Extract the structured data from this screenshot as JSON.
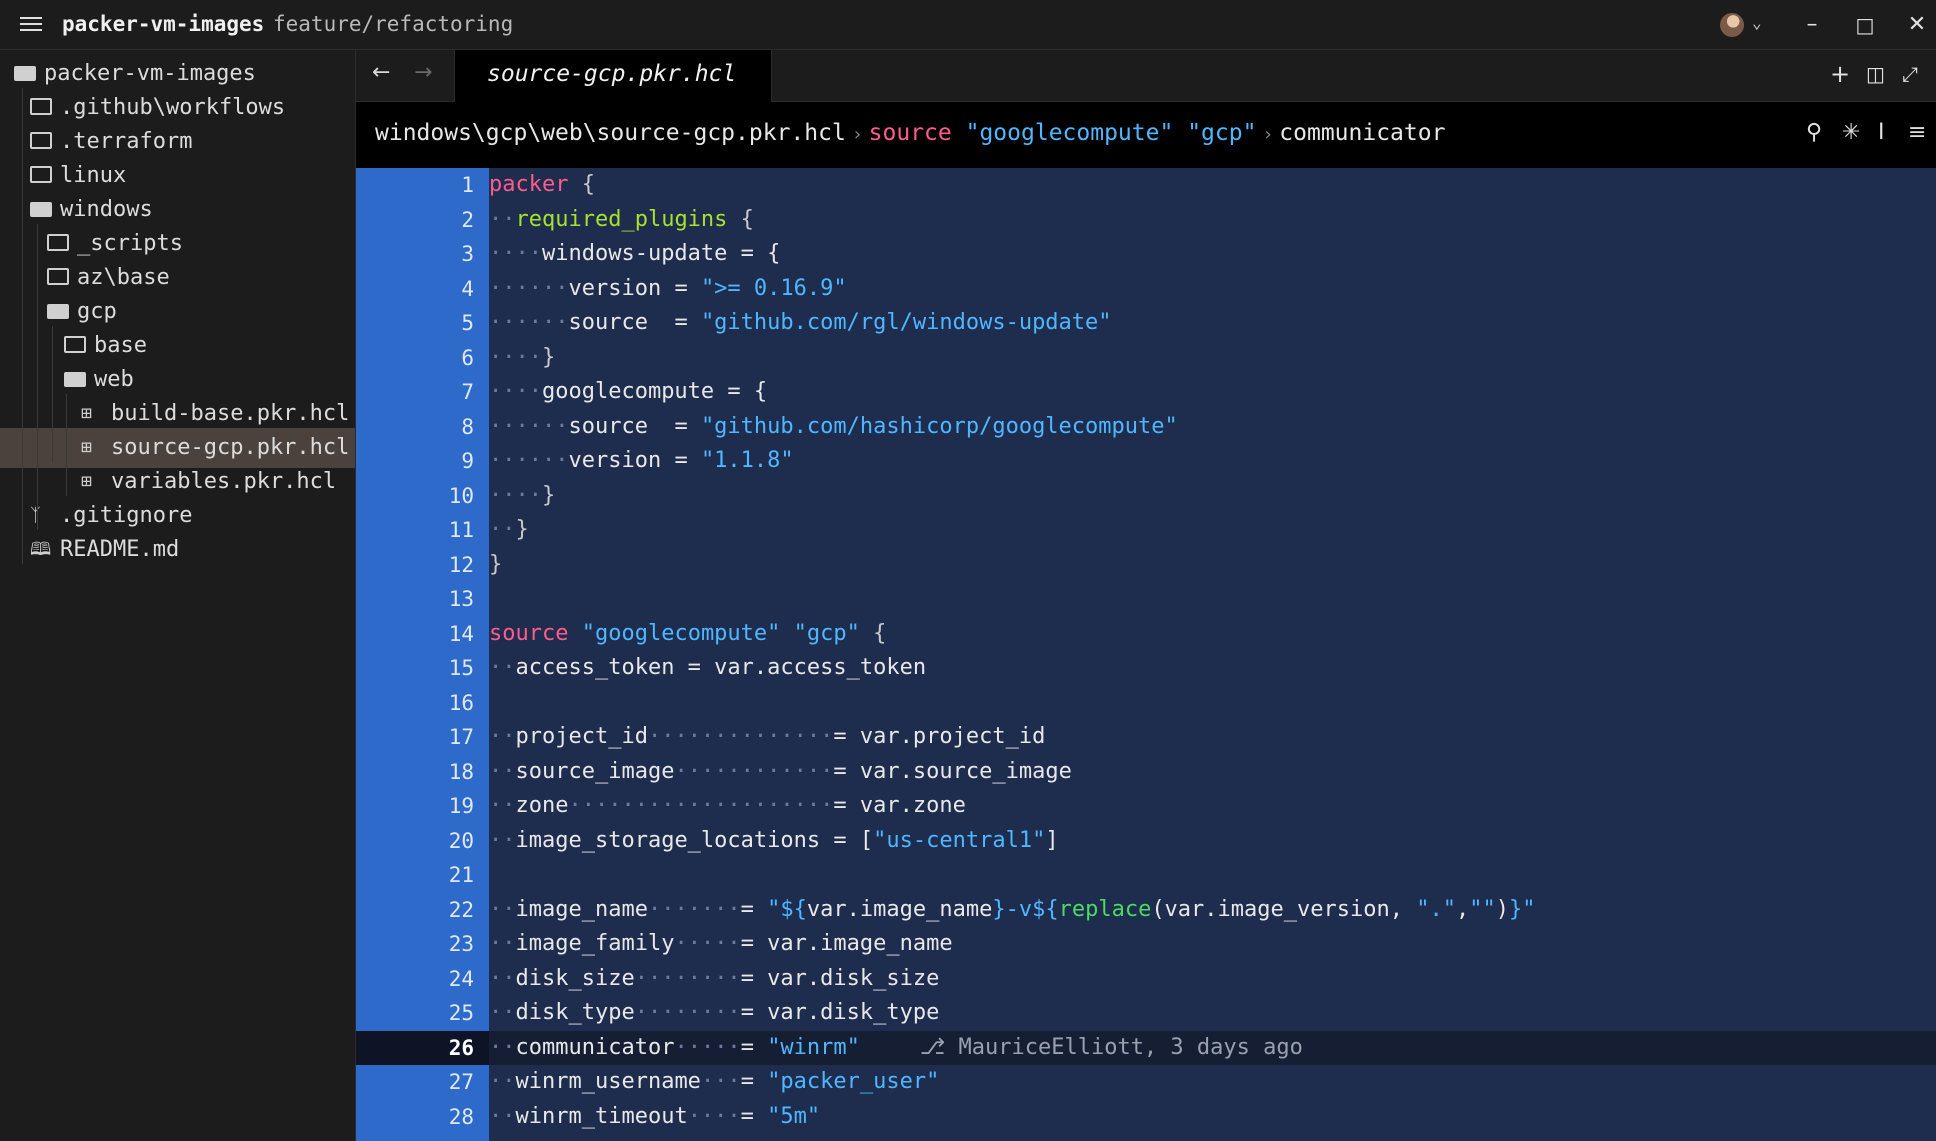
{
  "titlebar": {
    "project": "packer-vm-images",
    "branch": "feature/refactoring"
  },
  "sidebar": {
    "items": [
      {
        "label": "packer-vm-images",
        "icon": "folder-open-icon",
        "depth": 0
      },
      {
        "label": ".github\\workflows",
        "icon": "folder-icon",
        "depth": 1
      },
      {
        "label": ".terraform",
        "icon": "folder-icon",
        "depth": 1
      },
      {
        "label": "linux",
        "icon": "folder-icon",
        "depth": 1
      },
      {
        "label": "windows",
        "icon": "folder-open-icon",
        "depth": 1
      },
      {
        "label": "_scripts",
        "icon": "folder-icon",
        "depth": 2
      },
      {
        "label": "az\\base",
        "icon": "folder-icon",
        "depth": 2
      },
      {
        "label": "gcp",
        "icon": "folder-open-icon",
        "depth": 2
      },
      {
        "label": "base",
        "icon": "folder-icon",
        "depth": 3
      },
      {
        "label": "web",
        "icon": "folder-open-icon",
        "depth": 3
      },
      {
        "label": "build-base.pkr.hcl",
        "icon": "hcl-file-icon",
        "depth": 4
      },
      {
        "label": "source-gcp.pkr.hcl",
        "icon": "hcl-file-icon",
        "depth": 4,
        "active": true
      },
      {
        "label": "variables.pkr.hcl",
        "icon": "hcl-file-icon",
        "depth": 4
      },
      {
        "label": ".gitignore",
        "icon": "git-icon",
        "depth": 1
      },
      {
        "label": "README.md",
        "icon": "book-icon",
        "depth": 1
      }
    ]
  },
  "tabs": {
    "active": "source-gcp.pkr.hcl"
  },
  "breadcrumb": {
    "path": "windows\\gcp\\web\\source-gcp.pkr.hcl",
    "kw": "source",
    "s1": "\"googlecompute\"",
    "s2": "\"gcp\"",
    "last": "communicator"
  },
  "editor": {
    "current_line": 26,
    "blame": "MauriceElliott, 3 days ago",
    "lines": [
      [
        [
          "kw",
          "packer"
        ],
        [
          "brace",
          " {"
        ]
      ],
      [
        [
          "ws",
          "··"
        ],
        [
          "attr",
          "required_plugins"
        ],
        [
          "brace",
          " {"
        ]
      ],
      [
        [
          "ws",
          "····"
        ],
        [
          "plain",
          "windows-update = {"
        ]
      ],
      [
        [
          "ws",
          "······"
        ],
        [
          "plain",
          "version = "
        ],
        [
          "str",
          "\">= 0.16.9\""
        ]
      ],
      [
        [
          "ws",
          "······"
        ],
        [
          "plain",
          "source  = "
        ],
        [
          "str",
          "\"github.com/rgl/windows-update\""
        ]
      ],
      [
        [
          "ws",
          "····"
        ],
        [
          "brace",
          "}"
        ]
      ],
      [
        [
          "ws",
          "····"
        ],
        [
          "plain",
          "googlecompute = {"
        ]
      ],
      [
        [
          "ws",
          "······"
        ],
        [
          "plain",
          "source  = "
        ],
        [
          "str",
          "\"github.com/hashicorp/googlecompute\""
        ]
      ],
      [
        [
          "ws",
          "······"
        ],
        [
          "plain",
          "version = "
        ],
        [
          "str",
          "\"1.1.8\""
        ]
      ],
      [
        [
          "ws",
          "····"
        ],
        [
          "brace",
          "}"
        ]
      ],
      [
        [
          "ws",
          "··"
        ],
        [
          "brace",
          "}"
        ]
      ],
      [
        [
          "brace",
          "}"
        ]
      ],
      [],
      [
        [
          "kw",
          "source"
        ],
        [
          "plain",
          " "
        ],
        [
          "str",
          "\"googlecompute\""
        ],
        [
          "plain",
          " "
        ],
        [
          "str",
          "\"gcp\""
        ],
        [
          "brace",
          " {"
        ]
      ],
      [
        [
          "ws",
          "··"
        ],
        [
          "plain",
          "access_token = var.access_token"
        ]
      ],
      [],
      [
        [
          "ws",
          "··"
        ],
        [
          "plain",
          "project_id"
        ],
        [
          "ws",
          "··············"
        ],
        [
          "plain",
          "= var.project_id"
        ]
      ],
      [
        [
          "ws",
          "··"
        ],
        [
          "plain",
          "source_image"
        ],
        [
          "ws",
          "············"
        ],
        [
          "plain",
          "= var.source_image"
        ]
      ],
      [
        [
          "ws",
          "··"
        ],
        [
          "plain",
          "zone"
        ],
        [
          "ws",
          "····················"
        ],
        [
          "plain",
          "= var.zone"
        ]
      ],
      [
        [
          "ws",
          "··"
        ],
        [
          "plain",
          "image_storage_locations = ["
        ],
        [
          "str",
          "\"us-central1\""
        ],
        [
          "plain",
          "]"
        ]
      ],
      [],
      [
        [
          "ws",
          "··"
        ],
        [
          "plain",
          "image_name"
        ],
        [
          "ws",
          "·······"
        ],
        [
          "plain",
          "= "
        ],
        [
          "str",
          "\"${"
        ],
        [
          "plain",
          "var.image_name"
        ],
        [
          "str",
          "}-v${"
        ],
        [
          "fn",
          "replace"
        ],
        [
          "plain",
          "(var.image_version, "
        ],
        [
          "str",
          "\".\""
        ],
        [
          "plain",
          ","
        ],
        [
          "str",
          "\"\""
        ],
        [
          "plain",
          ")"
        ],
        [
          "str",
          "}\""
        ]
      ],
      [
        [
          "ws",
          "··"
        ],
        [
          "plain",
          "image_family"
        ],
        [
          "ws",
          "·····"
        ],
        [
          "plain",
          "= var.image_name"
        ]
      ],
      [
        [
          "ws",
          "··"
        ],
        [
          "plain",
          "disk_size"
        ],
        [
          "ws",
          "········"
        ],
        [
          "plain",
          "= var.disk_size"
        ]
      ],
      [
        [
          "ws",
          "··"
        ],
        [
          "plain",
          "disk_type"
        ],
        [
          "ws",
          "········"
        ],
        [
          "plain",
          "= var.disk_type"
        ]
      ],
      [
        [
          "ws",
          "··"
        ],
        [
          "plain",
          "communicator"
        ],
        [
          "ws",
          "·····"
        ],
        [
          "plain",
          "= "
        ],
        [
          "str",
          "\"winrm\""
        ]
      ],
      [
        [
          "ws",
          "··"
        ],
        [
          "plain",
          "winrm_username"
        ],
        [
          "ws",
          "···"
        ],
        [
          "plain",
          "= "
        ],
        [
          "str",
          "\"packer_user\""
        ]
      ],
      [
        [
          "ws",
          "··"
        ],
        [
          "plain",
          "winrm_timeout"
        ],
        [
          "ws",
          "····"
        ],
        [
          "plain",
          "= "
        ],
        [
          "str",
          "\"5m\""
        ]
      ]
    ]
  }
}
